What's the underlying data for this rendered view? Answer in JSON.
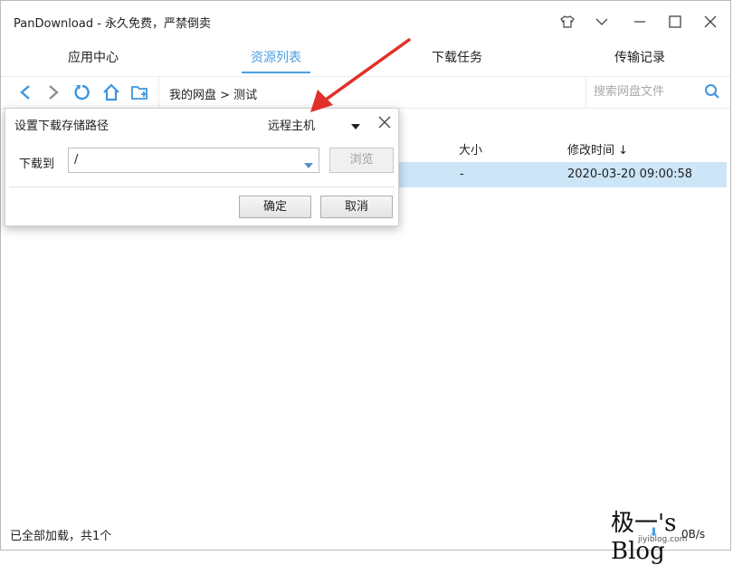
{
  "window": {
    "title": "PanDownload - 永久免费，严禁倒卖"
  },
  "tabs": [
    {
      "label": "应用中心",
      "active": false
    },
    {
      "label": "资源列表",
      "active": true
    },
    {
      "label": "下载任务",
      "active": false
    },
    {
      "label": "传输记录",
      "active": false
    }
  ],
  "toolbar": {
    "icons": [
      "back-icon",
      "forward-icon",
      "refresh-icon",
      "home-icon",
      "new-folder-icon"
    ],
    "breadcrumb": "我的网盘 > 测试",
    "search_placeholder": "搜索网盘文件"
  },
  "file_table": {
    "columns": {
      "size": "大小",
      "modified": "修改时间 ↓"
    },
    "rows": [
      {
        "size": "-",
        "modified": "2020-03-20 09:00:58",
        "selected": true
      }
    ]
  },
  "dialog": {
    "title": "设置下载存储路径",
    "remote_host": "远程主机",
    "download_to_label": "下载到",
    "path_value": "/",
    "browse_label": "浏览",
    "ok_label": "确定",
    "cancel_label": "取消"
  },
  "status_bar": {
    "summary": "已全部加载，共1个",
    "speed": "0B/s"
  },
  "watermark": {
    "text": "极一's Blog",
    "url": "jiyiblog.com"
  },
  "colors": {
    "accent": "#4a9fe3",
    "selected_row": "#cce6f8",
    "annotation_arrow": "#e0302a"
  }
}
